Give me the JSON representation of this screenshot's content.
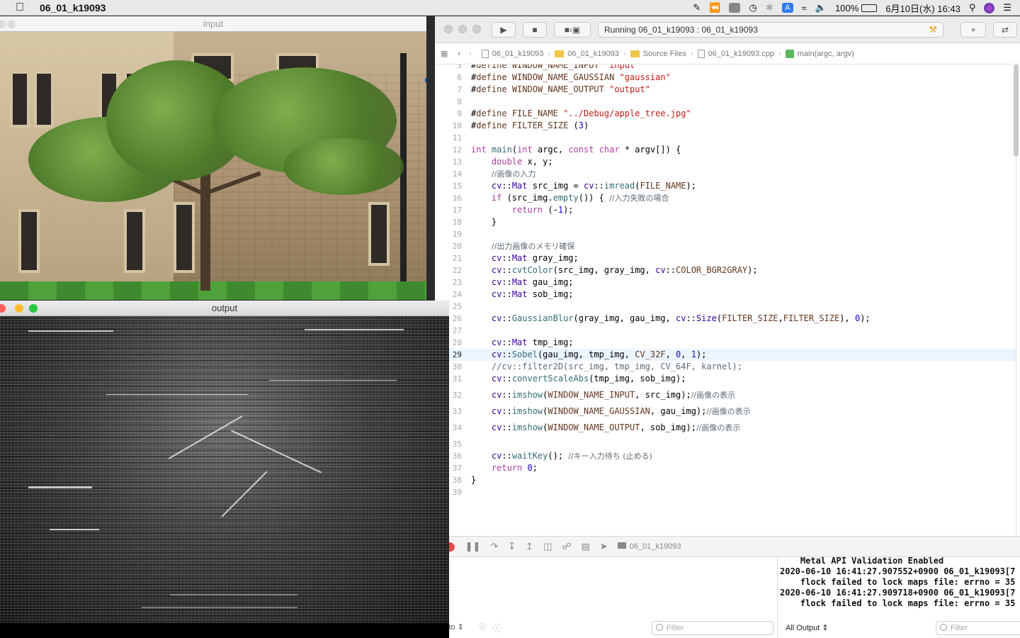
{
  "menubar": {
    "app_name": "06_01_k19093",
    "battery": "100%",
    "datetime": "6月10日(水)  16:43",
    "input_mode": "A"
  },
  "input_window": {
    "title": "input"
  },
  "output_window": {
    "title": "output"
  },
  "xcode": {
    "activity": "Running 06_01_k19093 : 06_01_k19093",
    "jumpbar": [
      "06_01_k19093",
      "06_01_k19093",
      "Source Files",
      "06_01_k19093.cpp",
      "main(argc, argv)"
    ],
    "debug_target": "06_01_k19093",
    "console_mode": "Auto",
    "output_select": "All Output",
    "filter_placeholder": "Filter",
    "console_lines": [
      "    Metal API Validation Enabled",
      "2020-06-10 16:41:27.907552+0900 06_01_k19093[7",
      "    flock failed to lock maps file: errno = 35",
      "2020-06-10 16:41:27.909718+0900 06_01_k19093[7",
      "    flock failed to lock maps file: errno = 35"
    ]
  },
  "code": {
    "current_line": 29,
    "lines": [
      {
        "n": 5,
        "t": "#define WINDOW_NAME_INPUT \"input\""
      },
      {
        "n": 6,
        "t": "#define WINDOW_NAME_GAUSSIAN \"gaussian\""
      },
      {
        "n": 7,
        "t": "#define WINDOW_NAME_OUTPUT \"output\""
      },
      {
        "n": 8,
        "t": ""
      },
      {
        "n": 9,
        "t": "#define FILE_NAME \"../Debug/apple_tree.jpg\""
      },
      {
        "n": 10,
        "t": "#define FILTER_SIZE (3)"
      },
      {
        "n": 11,
        "t": ""
      },
      {
        "n": 12,
        "t": "int main(int argc, const char * argv[]) {"
      },
      {
        "n": 13,
        "t": "    double x, y;"
      },
      {
        "n": 14,
        "t": "    //画像の入力"
      },
      {
        "n": 15,
        "t": "    cv::Mat src_img = cv::imread(FILE_NAME);"
      },
      {
        "n": 16,
        "t": "    if (src_img.empty()) { //入力失敗の場合"
      },
      {
        "n": 17,
        "t": "        return (-1);"
      },
      {
        "n": 18,
        "t": "    }"
      },
      {
        "n": 19,
        "t": ""
      },
      {
        "n": 20,
        "t": "    //出力画像のメモリ確保"
      },
      {
        "n": 21,
        "t": "    cv::Mat gray_img;"
      },
      {
        "n": 22,
        "t": "    cv::cvtColor(src_img, gray_img, cv::COLOR_BGR2GRAY);"
      },
      {
        "n": 23,
        "t": "    cv::Mat gau_img;"
      },
      {
        "n": 24,
        "t": "    cv::Mat sob_img;"
      },
      {
        "n": 25,
        "t": ""
      },
      {
        "n": 26,
        "t": "    cv::GaussianBlur(gray_img, gau_img, cv::Size(FILTER_SIZE,FILTER_SIZE), 0);"
      },
      {
        "n": 27,
        "t": ""
      },
      {
        "n": 28,
        "t": "    cv::Mat tmp_img;"
      },
      {
        "n": 29,
        "t": "    cv::Sobel(gau_img, tmp_img, CV_32F, 0, 1);"
      },
      {
        "n": 30,
        "t": "    //cv::filter2D(src_img, tmp_img, CV_64F, karnel);"
      },
      {
        "n": 31,
        "t": "    cv::convertScaleAbs(tmp_img, sob_img);"
      },
      {
        "n": 32,
        "t": "    cv::imshow(WINDOW_NAME_INPUT, src_img);//画像の表示"
      },
      {
        "n": 33,
        "t": "    cv::imshow(WINDOW_NAME_GAUSSIAN, gau_img);//画像の表示"
      },
      {
        "n": 34,
        "t": "    cv::imshow(WINDOW_NAME_OUTPUT, sob_img);//画像の表示"
      },
      {
        "n": 35,
        "t": ""
      },
      {
        "n": 36,
        "t": "    cv::waitKey(); //キー入力待ち (止める)"
      },
      {
        "n": 37,
        "t": "    return 0;"
      },
      {
        "n": 38,
        "t": "}"
      },
      {
        "n": 39,
        "t": ""
      }
    ]
  }
}
